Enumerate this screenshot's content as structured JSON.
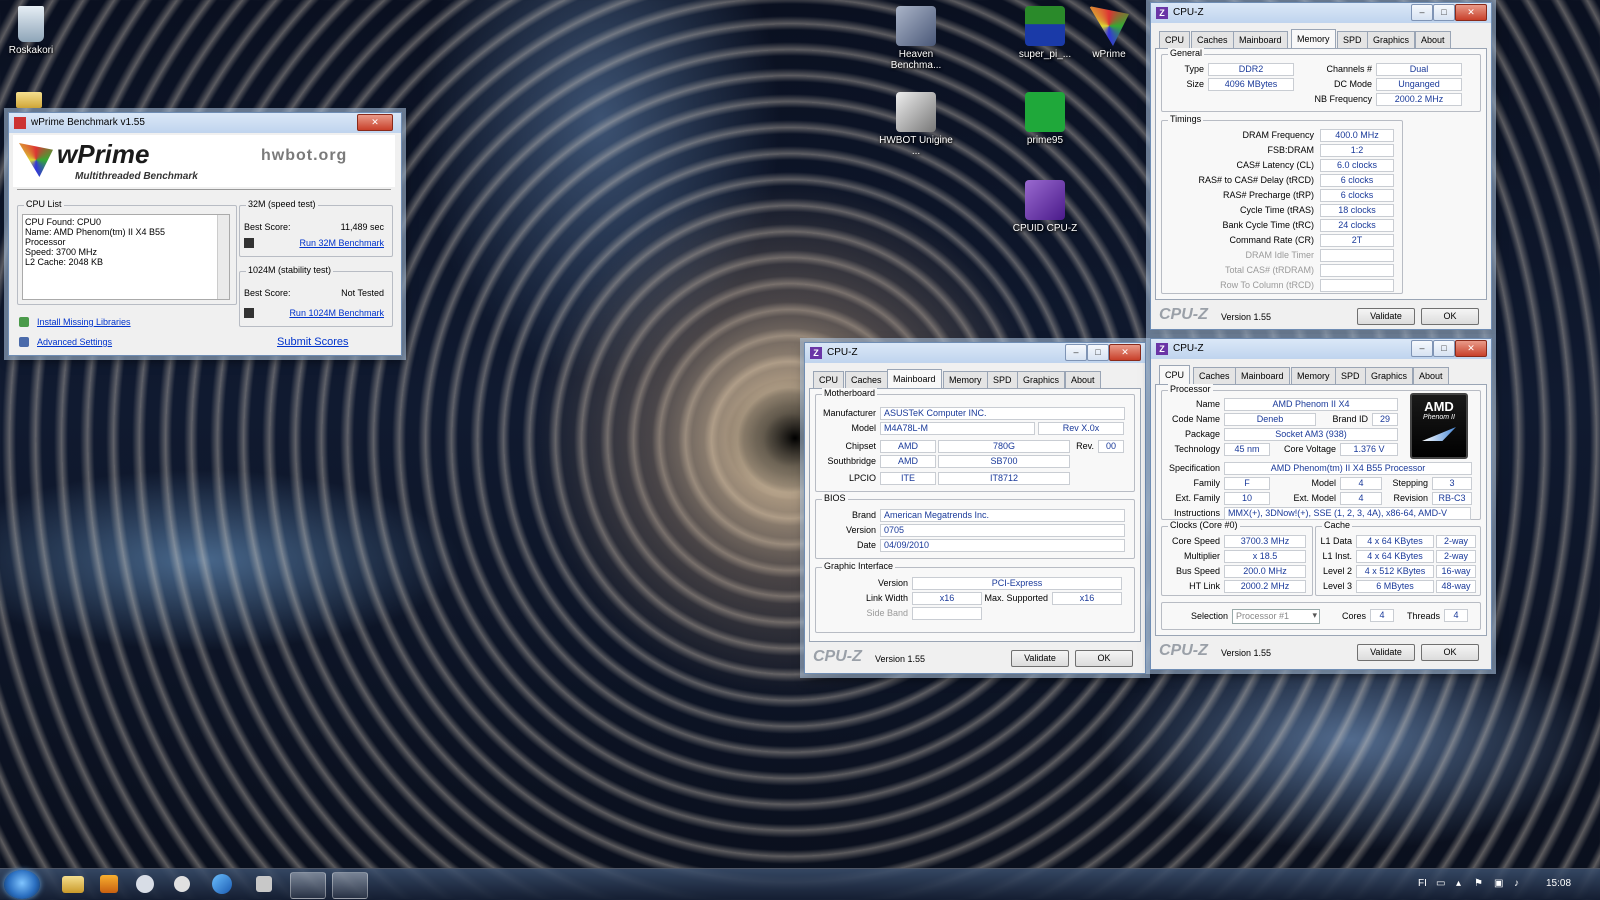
{
  "desktop": {
    "icons": [
      {
        "label": "Roskakori"
      },
      {
        "label": "Heaven Benchma..."
      },
      {
        "label": "super_pi_..."
      },
      {
        "label": "wPrime"
      },
      {
        "label": "HWBOT Unigine ..."
      },
      {
        "label": "prime95"
      },
      {
        "label": "CPUID CPU-Z"
      }
    ]
  },
  "wprime": {
    "title": "wPrime Benchmark v1.55",
    "logo": "wPrime",
    "subtitle": "Multithreaded Benchmark",
    "hwbot": "hwbot.org",
    "cpu_list_label": "CPU List",
    "cpu_lines": [
      "CPU Found: CPU0",
      "Name:    AMD Phenom(tm) II X4 B55",
      "Processor",
      "Speed:   3700 MHz",
      "L2 Cache: 2048 KB"
    ],
    "test32_label": "32M (speed test)",
    "test32_best_label": "Best Score:",
    "test32_best_value": "11,489 sec",
    "test32_run": "Run 32M Benchmark",
    "test1024_label": "1024M (stability test)",
    "test1024_best_label": "Best Score:",
    "test1024_best_value": "Not Tested",
    "test1024_run": "Run 1024M Benchmark",
    "install_libs": "Install Missing Libraries",
    "advanced": "Advanced Settings",
    "submit": "Submit Scores"
  },
  "cpuz_common": {
    "title": "CPU-Z",
    "tabs": [
      "CPU",
      "Caches",
      "Mainboard",
      "Memory",
      "SPD",
      "Graphics",
      "About"
    ],
    "logo": "CPU-Z",
    "version": "Version 1.55",
    "validate": "Validate",
    "ok": "OK"
  },
  "memory": {
    "general_label": "General",
    "type_label": "Type",
    "type": "DDR2",
    "size_label": "Size",
    "size": "4096 MBytes",
    "channels_label": "Channels #",
    "channels": "Dual",
    "dcmode_label": "DC Mode",
    "dcmode": "Unganged",
    "nbfreq_label": "NB Frequency",
    "nbfreq": "2000.2 MHz",
    "timings_label": "Timings",
    "timings": [
      {
        "label": "DRAM Frequency",
        "value": "400.0 MHz"
      },
      {
        "label": "FSB:DRAM",
        "value": "1:2"
      },
      {
        "label": "CAS# Latency (CL)",
        "value": "6.0 clocks"
      },
      {
        "label": "RAS# to CAS# Delay (tRCD)",
        "value": "6 clocks"
      },
      {
        "label": "RAS# Precharge (tRP)",
        "value": "6 clocks"
      },
      {
        "label": "Cycle Time (tRAS)",
        "value": "18 clocks"
      },
      {
        "label": "Bank Cycle Time (tRC)",
        "value": "24 clocks"
      },
      {
        "label": "Command Rate (CR)",
        "value": "2T"
      },
      {
        "label": "DRAM Idle Timer",
        "value": ""
      },
      {
        "label": "Total CAS# (tRDRAM)",
        "value": ""
      },
      {
        "label": "Row To Column (tRCD)",
        "value": ""
      }
    ]
  },
  "mainboard": {
    "mb_label": "Motherboard",
    "manufacturer_label": "Manufacturer",
    "manufacturer": "ASUSTeK Computer INC.",
    "model_label": "Model",
    "model": "M4A78L-M",
    "model_rev": "Rev X.0x",
    "chipset_label": "Chipset",
    "chipset_vendor": "AMD",
    "chipset": "780G",
    "rev_label": "Rev.",
    "rev": "00",
    "southbridge_label": "Southbridge",
    "sb_vendor": "AMD",
    "sb": "SB700",
    "lpcio_label": "LPCIO",
    "lpcio_vendor": "ITE",
    "lpcio": "IT8712",
    "bios_label": "BIOS",
    "brand_label": "Brand",
    "brand": "American Megatrends Inc.",
    "version_label": "Version",
    "version": "0705",
    "date_label": "Date",
    "date": "04/09/2010",
    "gi_label": "Graphic Interface",
    "gi_version_label": "Version",
    "gi_version": "PCI-Express",
    "linkwidth_label": "Link Width",
    "linkwidth": "x16",
    "maxsup_label": "Max. Supported",
    "maxsup": "x16",
    "sideband_label": "Side Band"
  },
  "cpu": {
    "processor_label": "Processor",
    "name_label": "Name",
    "name": "AMD Phenom II X4",
    "codename_label": "Code Name",
    "codename": "Deneb",
    "brandid_label": "Brand ID",
    "brandid": "29",
    "package_label": "Package",
    "package": "Socket AM3 (938)",
    "technology_label": "Technology",
    "technology": "45 nm",
    "corevoltage_label": "Core Voltage",
    "corevoltage": "1.376 V",
    "spec_label": "Specification",
    "spec": "AMD Phenom(tm) II X4 B55 Processor",
    "family_label": "Family",
    "family": "F",
    "model_label": "Model",
    "model": "4",
    "stepping_label": "Stepping",
    "stepping": "3",
    "extfamily_label": "Ext. Family",
    "extfamily": "10",
    "extmodel_label": "Ext. Model",
    "extmodel": "4",
    "revision_label": "Revision",
    "revision": "RB-C3",
    "instructions_label": "Instructions",
    "instructions": "MMX(+), 3DNow!(+), SSE (1, 2, 3, 4A), x86-64, AMD-V",
    "clocks_label": "Clocks (Core #0)",
    "corespeed_label": "Core Speed",
    "corespeed": "3700.3 MHz",
    "multiplier_label": "Multiplier",
    "multiplier": "x 18.5",
    "busspeed_label": "Bus Speed",
    "busspeed": "200.0 MHz",
    "htlink_label": "HT Link",
    "htlink": "2000.2 MHz",
    "cache_label": "Cache",
    "l1d_label": "L1 Data",
    "l1d": "4 x 64 KBytes",
    "l1d_way": "2-way",
    "l1i_label": "L1 Inst.",
    "l1i": "4 x 64 KBytes",
    "l1i_way": "2-way",
    "l2_label": "Level 2",
    "l2": "4 x 512 KBytes",
    "l2_way": "16-way",
    "l3_label": "Level 3",
    "l3": "6 MBytes",
    "l3_way": "48-way",
    "selection_label": "Selection",
    "selection": "Processor #1",
    "cores_label": "Cores",
    "cores": "4",
    "threads_label": "Threads",
    "threads": "4",
    "amd_logo": "AMD",
    "amd_sub": "Phenom II"
  },
  "taskbar": {
    "lang": "FI",
    "clock": "15:08"
  },
  "colors": {
    "cpuz_purple": "#6a35a6",
    "value_blue": "#1a3a9a"
  }
}
